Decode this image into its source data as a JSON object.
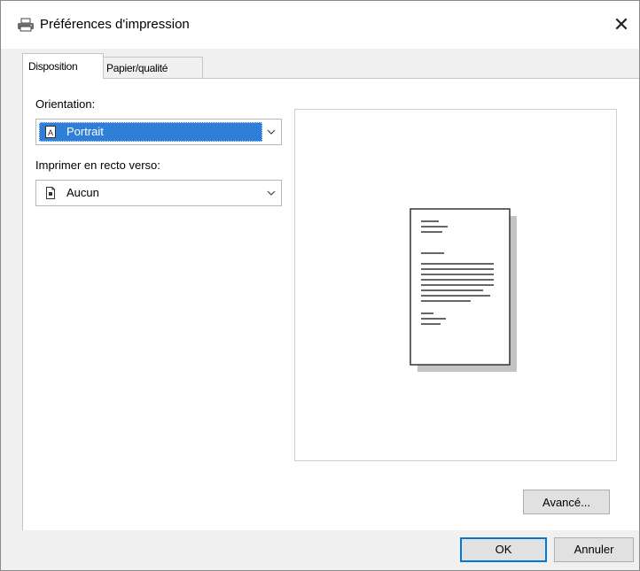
{
  "window": {
    "title": "Préférences d'impression",
    "close_glyph": "✕",
    "icon": "printer-icon"
  },
  "tabs": [
    {
      "label": "Disposition",
      "active": true
    },
    {
      "label": "Papier/qualité",
      "active": false
    }
  ],
  "orientation": {
    "label": "Orientation:",
    "value": "Portrait",
    "icon": "portrait-page-icon",
    "highlight_color": "#2f7ed8"
  },
  "duplex": {
    "label": "Imprimer en recto verso:",
    "value": "Aucun",
    "icon": "single-sided-page-icon"
  },
  "preview": {
    "icon": "document-preview-icon"
  },
  "buttons": {
    "advanced": "Avancé...",
    "ok": "OK",
    "cancel": "Annuler"
  },
  "colors": {
    "accent": "#0078d7",
    "selection": "#2f7ed8"
  }
}
